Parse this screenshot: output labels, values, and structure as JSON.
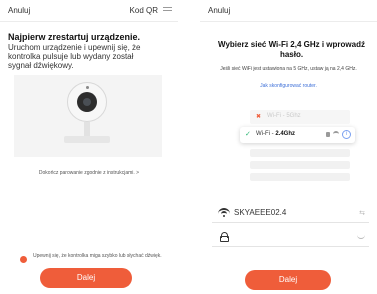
{
  "left_screen": {
    "header": {
      "cancel_label": "Anuluj",
      "qr_label": "Kod QR",
      "qr_icon": "list-icon"
    },
    "title": "Najpierw zrestartuj urządzenie.",
    "description": "Uruchom urządzenie i upewnij się, że kontrolka pulsuje lub wydany został sygnał dźwiękowy.",
    "instruction_link": "Dokończ parowanie zgodnie z instrukcjami. >",
    "confirm_text": "Upewnij się, że kontrolka miga szybko lub słychać dźwięk.",
    "next_button": "Dalej",
    "accent_color": "#ef5d3a"
  },
  "right_screen": {
    "header": {
      "cancel_label": "Anuluj"
    },
    "title": "Wybierz sieć Wi-Fi 2,4 GHz i wprowadź hasło.",
    "subtitle": "Jeśli sieć WiFi jest ustawiona na 5 GHz, ustaw ją na 2,4 GHz.",
    "router_link": "Jak skonfigurować router.",
    "illustration": {
      "unsupported_label": "Wi-Fi - 5Ghz",
      "supported_prefix": "Wi-Fi - ",
      "supported_band": "2.4Ghz"
    },
    "ssid_value": "SKYAEEE02.4",
    "password_value": "",
    "next_button": "Dalej",
    "link_color": "#3d6fd8"
  }
}
